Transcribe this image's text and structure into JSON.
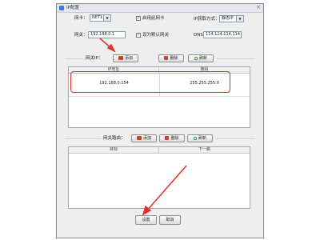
{
  "window": {
    "title": "IP配置",
    "close_glyph": "×"
  },
  "network": {
    "nic_label": "网卡：",
    "nic_value": "NET1",
    "enable_label": "启用此网卡",
    "enable_checked": true,
    "ip_mode_label": "IP获取方式：",
    "ip_mode_value": "静态IP"
  },
  "gateway": {
    "label": "网关：",
    "value": "192.168.0.1",
    "default_label": "设为默认网关",
    "default_checked": true,
    "dns_label": "DNS：",
    "dns_value": "114.114.114.114"
  },
  "ip_section": {
    "label": "网关IP：",
    "add_label": "添加",
    "delete_label": "删除",
    "refresh_label": "刷新",
    "columns": [
      "IP地址",
      "掩码"
    ],
    "rows": [
      [
        "192.168.0.154",
        "255.255.255.0"
      ]
    ]
  },
  "route_section": {
    "label": "网关路由：",
    "add_label": "添加",
    "delete_label": "删除",
    "refresh_label": "刷新",
    "columns": [
      "目标",
      "下一跳"
    ]
  },
  "footer": {
    "ok_label": "设置",
    "cancel_label": "取消"
  },
  "annotation_color": "#e0302a"
}
